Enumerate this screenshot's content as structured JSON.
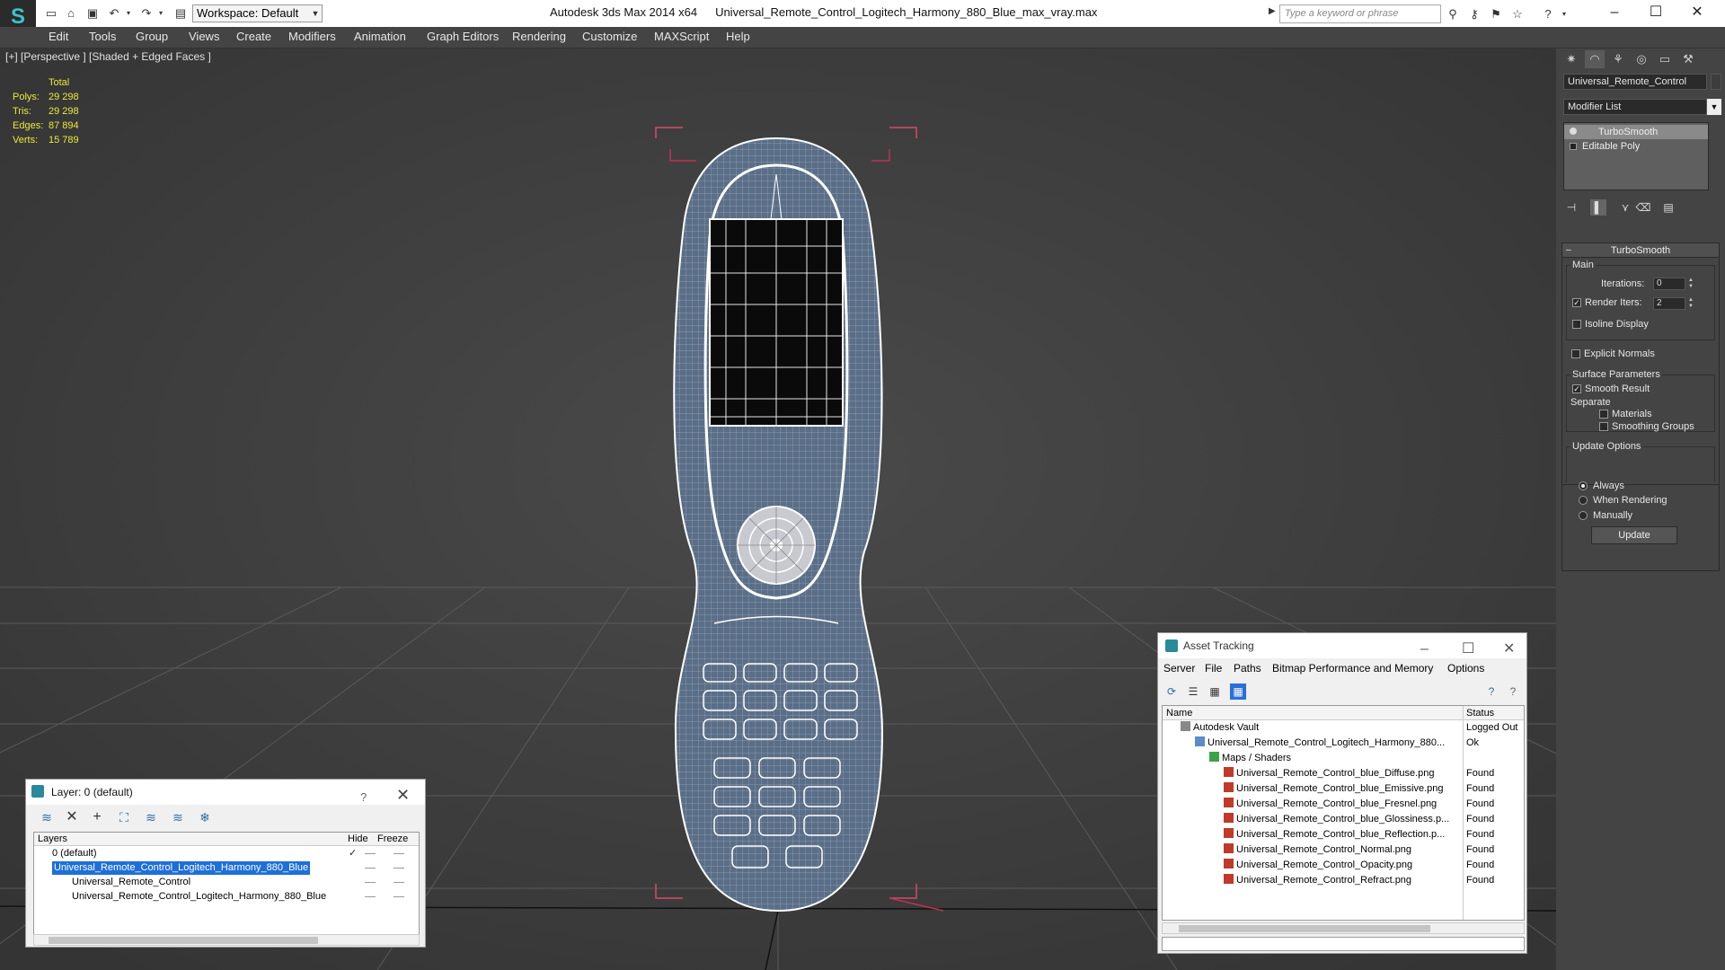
{
  "app": {
    "title_app": "Autodesk 3ds Max  2014 x64",
    "title_file": "Universal_Remote_Control_Logitech_Harmony_880_Blue_max_vray.max",
    "workspace": "Workspace: Default",
    "search_placeholder": "Type a keyword or phrase"
  },
  "menu": [
    "Edit",
    "Tools",
    "Group",
    "Views",
    "Create",
    "Modifiers",
    "Animation",
    "Graph Editors",
    "Rendering",
    "Customize",
    "MAXScript",
    "Help"
  ],
  "viewport": {
    "label": "[+] [Perspective ] [Shaded + Edged Faces ]",
    "stats": {
      "header": "Total",
      "rows": [
        {
          "label": "Polys:",
          "value": "29 298"
        },
        {
          "label": "Tris:",
          "value": "29 298"
        },
        {
          "label": "Edges:",
          "value": "87 894"
        },
        {
          "label": "Verts:",
          "value": "15 789"
        }
      ]
    }
  },
  "layer_window": {
    "title": "Layer: 0 (default)",
    "help": "?",
    "columns": {
      "layers": "Layers",
      "hide": "Hide",
      "freeze": "Freeze"
    },
    "rows": [
      {
        "name": "0 (default)"
      },
      {
        "name": "Universal_Remote_Control_Logitech_Harmony_880_Blue"
      },
      {
        "name": "Universal_Remote_Control"
      },
      {
        "name": "Universal_Remote_Control_Logitech_Harmony_880_Blue"
      }
    ]
  },
  "command_panel": {
    "object_name": "Universal_Remote_Control",
    "modifier_list": "Modifier List",
    "stack": [
      "TurboSmooth",
      "Editable Poly"
    ],
    "turbosmooth": {
      "title": "TurboSmooth",
      "main": "Main",
      "iterations_label": "Iterations:",
      "iterations": "0",
      "render_iters_label": "Render Iters:",
      "render_iters": "2",
      "isoline": "Isoline Display",
      "explicit_normals": "Explicit Normals",
      "surface_params": "Surface Parameters",
      "smooth_result": "Smooth Result",
      "separate": "Separate",
      "materials": "Materials",
      "smoothing_groups": "Smoothing Groups",
      "update_options": "Update Options",
      "always": "Always",
      "when_rendering": "When Rendering",
      "manually": "Manually",
      "update_button": "Update"
    }
  },
  "asset_tracking": {
    "title": "Asset Tracking",
    "menu": [
      "Server",
      "File",
      "Paths",
      "Bitmap Performance and Memory",
      "Options"
    ],
    "columns": {
      "name": "Name",
      "status": "Status"
    },
    "rows": [
      {
        "name": "Autodesk Vault",
        "status": "Logged Out"
      },
      {
        "name": "Universal_Remote_Control_Logitech_Harmony_880...",
        "status": "Ok"
      },
      {
        "name": "Maps / Shaders",
        "status": ""
      },
      {
        "name": "Universal_Remote_Control_blue_Diffuse.png",
        "status": "Found"
      },
      {
        "name": "Universal_Remote_Control_blue_Emissive.png",
        "status": "Found"
      },
      {
        "name": "Universal_Remote_Control_blue_Fresnel.png",
        "status": "Found"
      },
      {
        "name": "Universal_Remote_Control_blue_Glossiness.p...",
        "status": "Found"
      },
      {
        "name": "Universal_Remote_Control_blue_Reflection.p...",
        "status": "Found"
      },
      {
        "name": "Universal_Remote_Control_Normal.png",
        "status": "Found"
      },
      {
        "name": "Universal_Remote_Control_Opacity.png",
        "status": "Found"
      },
      {
        "name": "Universal_Remote_Control_Refract.png",
        "status": "Found"
      }
    ]
  },
  "colors": {
    "viewport_bg": "#3d3d3d",
    "wire": "#ffffff",
    "selection_bracket": "#d84a6a",
    "stats_text": "#eaea3a",
    "selection_blue": "#1e6fd9"
  }
}
